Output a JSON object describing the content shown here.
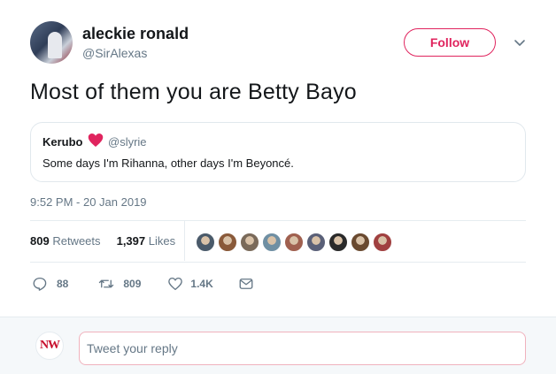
{
  "tweet": {
    "author_name": "aleckie ronald",
    "author_handle": "@SirAlexas",
    "follow_label": "Follow",
    "text": "Most of them you are Betty Bayo",
    "timestamp": "9:52 PM - 20 Jan 2019"
  },
  "quote": {
    "name": "Kerubo",
    "handle": "@slyrie",
    "text": "Some days I'm Rihanna, other days I'm Beyoncé."
  },
  "stats": {
    "retweets_count": "809",
    "retweets_label": "Retweets",
    "likes_count": "1,397",
    "likes_label": "Likes"
  },
  "actions": {
    "replies": "88",
    "retweets": "809",
    "likes": "1.4K"
  },
  "reply": {
    "avatar_text": "NW",
    "placeholder": "Tweet your reply"
  },
  "colors": {
    "accent": "#e0245e",
    "heart": "#e0245e",
    "muted": "#657786"
  },
  "liker_avatars": [
    "#4a5a6a",
    "#8a5a3a",
    "#7a6a5a",
    "#6f8fa3",
    "#a0604f",
    "#5a6078",
    "#2a2a2a",
    "#6a4a30",
    "#a04040"
  ]
}
